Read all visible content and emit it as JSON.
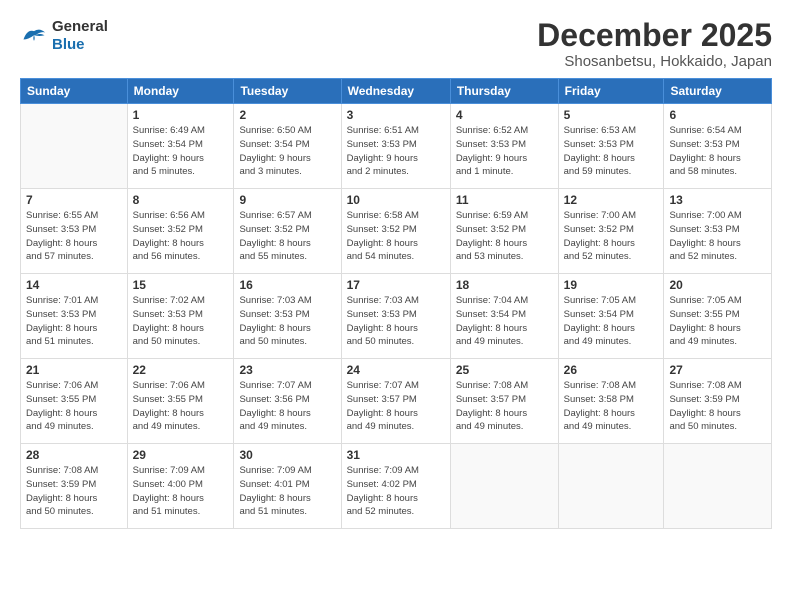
{
  "logo": {
    "general": "General",
    "blue": "Blue"
  },
  "header": {
    "month": "December 2025",
    "location": "Shosanbetsu, Hokkaido, Japan"
  },
  "weekdays": [
    "Sunday",
    "Monday",
    "Tuesday",
    "Wednesday",
    "Thursday",
    "Friday",
    "Saturday"
  ],
  "weeks": [
    [
      {
        "day": "",
        "info": ""
      },
      {
        "day": "1",
        "info": "Sunrise: 6:49 AM\nSunset: 3:54 PM\nDaylight: 9 hours\nand 5 minutes."
      },
      {
        "day": "2",
        "info": "Sunrise: 6:50 AM\nSunset: 3:54 PM\nDaylight: 9 hours\nand 3 minutes."
      },
      {
        "day": "3",
        "info": "Sunrise: 6:51 AM\nSunset: 3:53 PM\nDaylight: 9 hours\nand 2 minutes."
      },
      {
        "day": "4",
        "info": "Sunrise: 6:52 AM\nSunset: 3:53 PM\nDaylight: 9 hours\nand 1 minute."
      },
      {
        "day": "5",
        "info": "Sunrise: 6:53 AM\nSunset: 3:53 PM\nDaylight: 8 hours\nand 59 minutes."
      },
      {
        "day": "6",
        "info": "Sunrise: 6:54 AM\nSunset: 3:53 PM\nDaylight: 8 hours\nand 58 minutes."
      }
    ],
    [
      {
        "day": "7",
        "info": "Sunrise: 6:55 AM\nSunset: 3:53 PM\nDaylight: 8 hours\nand 57 minutes."
      },
      {
        "day": "8",
        "info": "Sunrise: 6:56 AM\nSunset: 3:52 PM\nDaylight: 8 hours\nand 56 minutes."
      },
      {
        "day": "9",
        "info": "Sunrise: 6:57 AM\nSunset: 3:52 PM\nDaylight: 8 hours\nand 55 minutes."
      },
      {
        "day": "10",
        "info": "Sunrise: 6:58 AM\nSunset: 3:52 PM\nDaylight: 8 hours\nand 54 minutes."
      },
      {
        "day": "11",
        "info": "Sunrise: 6:59 AM\nSunset: 3:52 PM\nDaylight: 8 hours\nand 53 minutes."
      },
      {
        "day": "12",
        "info": "Sunrise: 7:00 AM\nSunset: 3:52 PM\nDaylight: 8 hours\nand 52 minutes."
      },
      {
        "day": "13",
        "info": "Sunrise: 7:00 AM\nSunset: 3:53 PM\nDaylight: 8 hours\nand 52 minutes."
      }
    ],
    [
      {
        "day": "14",
        "info": "Sunrise: 7:01 AM\nSunset: 3:53 PM\nDaylight: 8 hours\nand 51 minutes."
      },
      {
        "day": "15",
        "info": "Sunrise: 7:02 AM\nSunset: 3:53 PM\nDaylight: 8 hours\nand 50 minutes."
      },
      {
        "day": "16",
        "info": "Sunrise: 7:03 AM\nSunset: 3:53 PM\nDaylight: 8 hours\nand 50 minutes."
      },
      {
        "day": "17",
        "info": "Sunrise: 7:03 AM\nSunset: 3:53 PM\nDaylight: 8 hours\nand 50 minutes."
      },
      {
        "day": "18",
        "info": "Sunrise: 7:04 AM\nSunset: 3:54 PM\nDaylight: 8 hours\nand 49 minutes."
      },
      {
        "day": "19",
        "info": "Sunrise: 7:05 AM\nSunset: 3:54 PM\nDaylight: 8 hours\nand 49 minutes."
      },
      {
        "day": "20",
        "info": "Sunrise: 7:05 AM\nSunset: 3:55 PM\nDaylight: 8 hours\nand 49 minutes."
      }
    ],
    [
      {
        "day": "21",
        "info": "Sunrise: 7:06 AM\nSunset: 3:55 PM\nDaylight: 8 hours\nand 49 minutes."
      },
      {
        "day": "22",
        "info": "Sunrise: 7:06 AM\nSunset: 3:55 PM\nDaylight: 8 hours\nand 49 minutes."
      },
      {
        "day": "23",
        "info": "Sunrise: 7:07 AM\nSunset: 3:56 PM\nDaylight: 8 hours\nand 49 minutes."
      },
      {
        "day": "24",
        "info": "Sunrise: 7:07 AM\nSunset: 3:57 PM\nDaylight: 8 hours\nand 49 minutes."
      },
      {
        "day": "25",
        "info": "Sunrise: 7:08 AM\nSunset: 3:57 PM\nDaylight: 8 hours\nand 49 minutes."
      },
      {
        "day": "26",
        "info": "Sunrise: 7:08 AM\nSunset: 3:58 PM\nDaylight: 8 hours\nand 49 minutes."
      },
      {
        "day": "27",
        "info": "Sunrise: 7:08 AM\nSunset: 3:59 PM\nDaylight: 8 hours\nand 50 minutes."
      }
    ],
    [
      {
        "day": "28",
        "info": "Sunrise: 7:08 AM\nSunset: 3:59 PM\nDaylight: 8 hours\nand 50 minutes."
      },
      {
        "day": "29",
        "info": "Sunrise: 7:09 AM\nSunset: 4:00 PM\nDaylight: 8 hours\nand 51 minutes."
      },
      {
        "day": "30",
        "info": "Sunrise: 7:09 AM\nSunset: 4:01 PM\nDaylight: 8 hours\nand 51 minutes."
      },
      {
        "day": "31",
        "info": "Sunrise: 7:09 AM\nSunset: 4:02 PM\nDaylight: 8 hours\nand 52 minutes."
      },
      {
        "day": "",
        "info": ""
      },
      {
        "day": "",
        "info": ""
      },
      {
        "day": "",
        "info": ""
      }
    ]
  ]
}
